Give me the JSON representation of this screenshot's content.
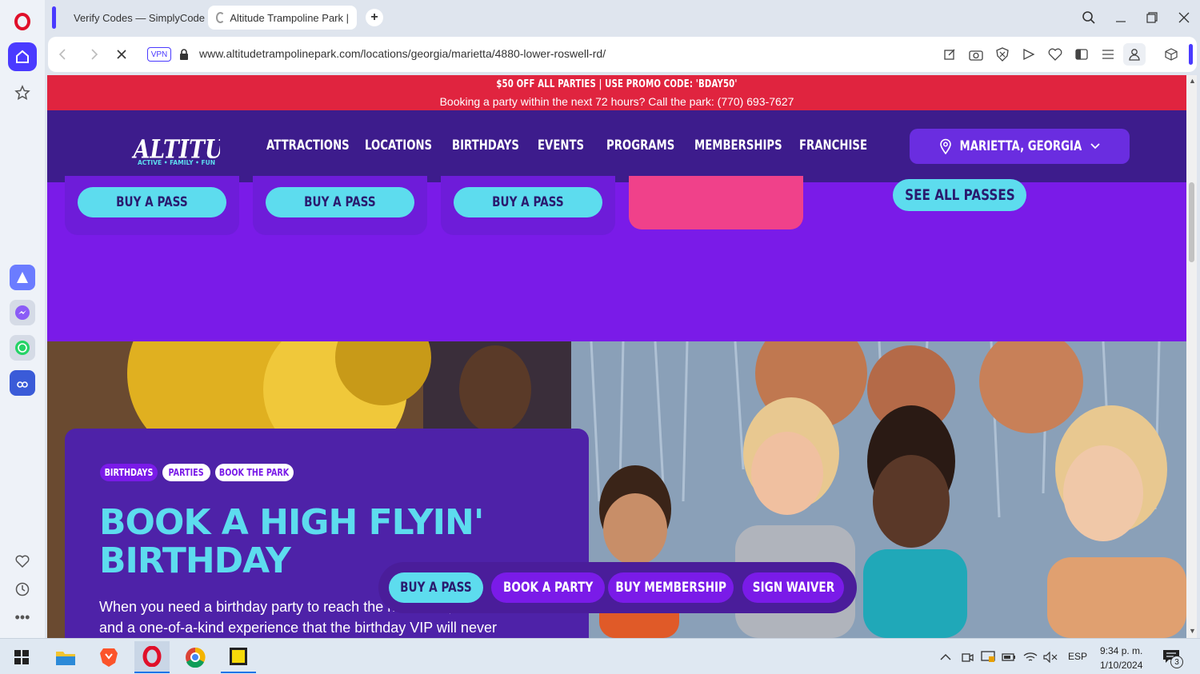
{
  "browser": {
    "tabs": [
      {
        "label": "Verify Codes — SimplyCodes",
        "active": false
      },
      {
        "label": "Altitude Trampoline Park |",
        "active": true
      }
    ],
    "address": {
      "vpn_label": "VPN",
      "url": "www.altitudetrampolinepark.com/locations/georgia/marietta/4880-lower-roswell-rd/"
    }
  },
  "page": {
    "promo": {
      "line1": "$50 OFF ALL PARTIES | USE PROMO CODE: 'BDAY50'",
      "line2": "Booking a party within the next 72 hours? Call the park: (770) 693-7627"
    },
    "logo": {
      "wordmark": "ALTITUDE",
      "tagline": "ACTIVE • FAMILY • FUN"
    },
    "nav": {
      "items": [
        "ATTRACTIONS",
        "LOCATIONS",
        "BIRTHDAYS",
        "EVENTS",
        "PROGRAMS",
        "MEMBERSHIPS",
        "FRANCHISE"
      ],
      "location": "MARIETTA, GEORGIA"
    },
    "passes": {
      "buy_label": "BUY A PASS",
      "see_all_label": "SEE ALL PASSES"
    },
    "hero": {
      "tags": [
        "BIRTHDAYS",
        "PARTIES",
        "BOOK THE PARK"
      ],
      "title": "BOOK A HIGH FLYIN' BIRTHDAY",
      "text": "When you need a birthday party to reach the next level, it's all access fun and a one-of-a-kind experience that the birthday VIP will never"
    },
    "cta": [
      "BUY A PASS",
      "BOOK A PARTY",
      "BUY MEMBERSHIP",
      "SIGN WAIVER"
    ]
  },
  "taskbar": {
    "lang": "ESP",
    "time": "9:34 p. m.",
    "date": "1/10/2024",
    "notifications": "3"
  },
  "colors": {
    "promo_red": "#e0243f",
    "nav_purple": "#3d1c8c",
    "page_purple": "#7a1be8",
    "accent_cyan": "#5ddcee",
    "pink_card": "#f0418a"
  }
}
